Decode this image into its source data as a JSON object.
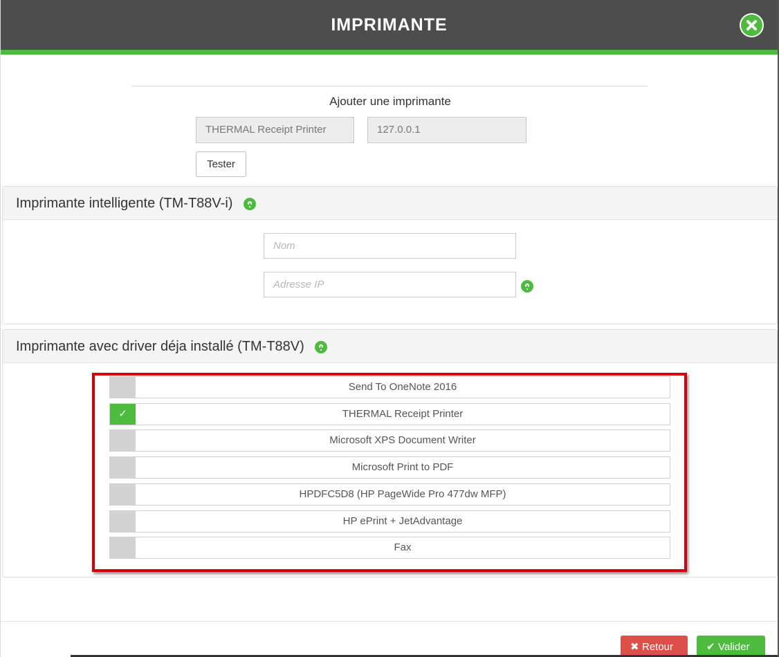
{
  "header": {
    "title": "IMPRIMANTE",
    "close_icon": "close-circle-icon",
    "accent_color": "#4cbb3e"
  },
  "add_section": {
    "title": "Ajouter une imprimante",
    "printer_name_value": "THERMAL Receipt Printer",
    "ip_value": "127.0.0.1",
    "test_label": "Tester"
  },
  "smart_printer": {
    "title": "Imprimante intelligente (TM-T88V-i)",
    "name_placeholder": "Nom",
    "ip_placeholder": "Adresse IP"
  },
  "driver_printer": {
    "title": "Imprimante avec driver déja installé (TM-T88V)",
    "printers": [
      {
        "label": "Send To OneNote 2016",
        "checked": false
      },
      {
        "label": "THERMAL Receipt Printer",
        "checked": true
      },
      {
        "label": "Microsoft XPS Document Writer",
        "checked": false
      },
      {
        "label": "Microsoft Print to PDF",
        "checked": false
      },
      {
        "label": "HPDFC5D8 (HP PageWide Pro 477dw MFP)",
        "checked": false
      },
      {
        "label": "HP ePrint + JetAdvantage",
        "checked": false
      },
      {
        "label": "Fax",
        "checked": false
      }
    ],
    "check_glyph": "✓"
  },
  "footer": {
    "back_label": "Retour",
    "back_icon": "✖",
    "validate_label": "Valider",
    "validate_icon": "✔",
    "back_color": "#de4f4a",
    "validate_color": "#4cbb3e"
  }
}
